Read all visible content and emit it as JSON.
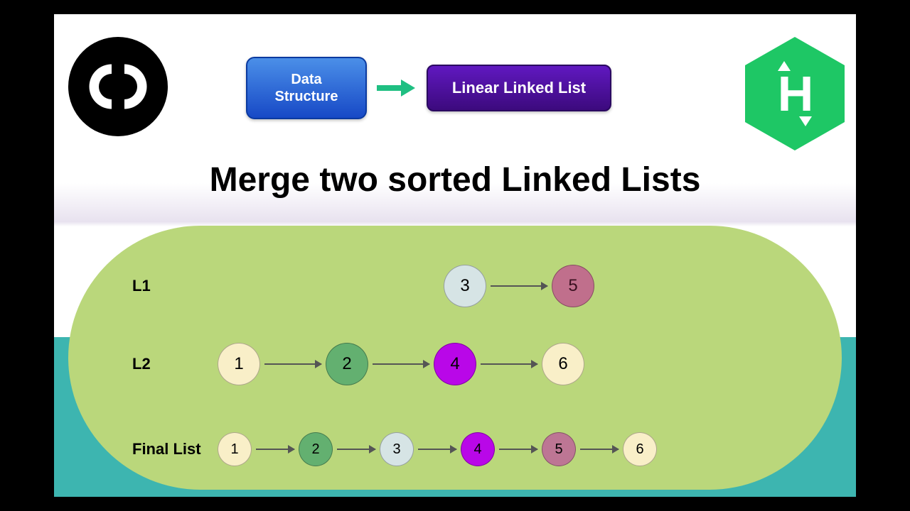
{
  "header": {
    "box1_line1": "Data",
    "box1_line2": "Structure",
    "box2": "Linear Linked List"
  },
  "title": "Merge two sorted Linked Lists",
  "logo_right_letter": "H",
  "lists": {
    "l1": {
      "label": "L1",
      "nodes": [
        {
          "value": "3",
          "color": "c-ltblue"
        },
        {
          "value": "5",
          "color": "c-pink"
        }
      ]
    },
    "l2": {
      "label": "L2",
      "nodes": [
        {
          "value": "1",
          "color": "c-cream"
        },
        {
          "value": "2",
          "color": "c-green"
        },
        {
          "value": "4",
          "color": "c-magenta"
        },
        {
          "value": "6",
          "color": "c-cream"
        }
      ]
    },
    "final": {
      "label": "Final List",
      "nodes": [
        {
          "value": "1",
          "color": "c-cream"
        },
        {
          "value": "2",
          "color": "c-green"
        },
        {
          "value": "3",
          "color": "c-ltblue"
        },
        {
          "value": "4",
          "color": "c-magenta"
        },
        {
          "value": "5",
          "color": "c-pink2"
        },
        {
          "value": "6",
          "color": "c-cream"
        }
      ]
    }
  }
}
